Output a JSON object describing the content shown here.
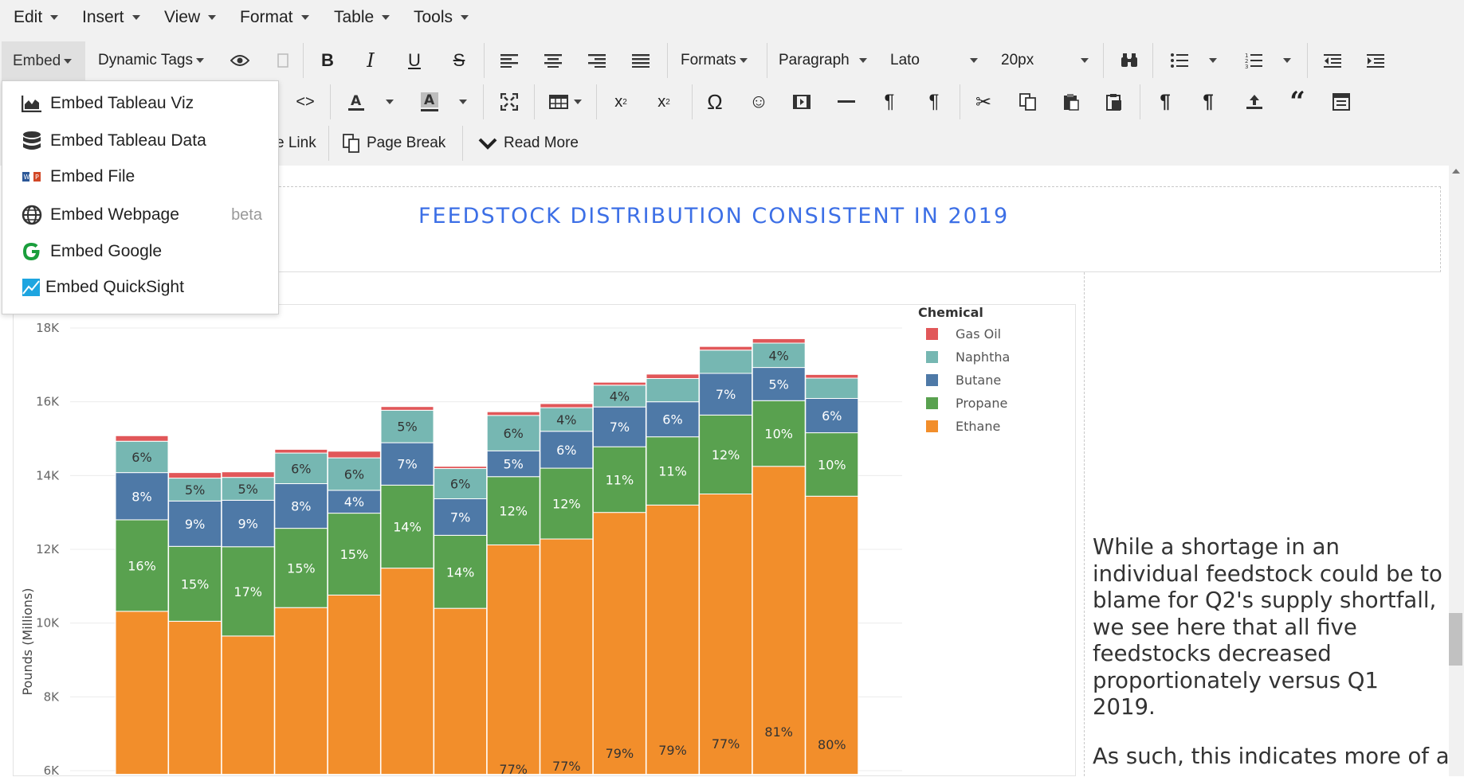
{
  "menubar": {
    "items": [
      "Edit",
      "Insert",
      "View",
      "Format",
      "Table",
      "Tools"
    ]
  },
  "toolbar": {
    "embed_label": "Embed",
    "dynamic_tags_label": "Dynamic Tags",
    "formats_label": "Formats",
    "paragraph_label": "Paragraph",
    "font_family_value": "Lato",
    "font_size_value": "20px",
    "link_label": "e Link",
    "page_break_label": "Page Break",
    "read_more_label": "Read More"
  },
  "embed_menu": {
    "items": [
      {
        "label": "Embed Tableau Viz",
        "icon": "area-chart-icon"
      },
      {
        "label": "Embed Tableau Data",
        "icon": "database-icon"
      },
      {
        "label": "Embed File",
        "icon": "file-icon"
      },
      {
        "label": "Embed Webpage",
        "icon": "globe-icon",
        "badge": "beta"
      },
      {
        "label": "Embed Google",
        "icon": "google-icon"
      },
      {
        "label": "Embed QuickSight",
        "icon": "quicksight-icon"
      }
    ]
  },
  "document": {
    "title": "FEEDSTOCK DISTRIBUTION CONSISTENT IN 2019",
    "paragraph1": [
      "While a shortage in an",
      "individual feedstock could be to",
      "blame for Q2's supply shortfall,",
      "we see here that all five",
      "feedstocks decreased",
      "proportionately versus Q1",
      "2019."
    ],
    "paragraph2_visible": "As such, this indicates more of a"
  },
  "colors": {
    "title": "#3c6fe6",
    "ethane": "#f28e2b",
    "propane": "#59a14f",
    "butane": "#4e79a7",
    "naphtha": "#76b7b2",
    "gas_oil": "#e15759"
  },
  "chart_data": {
    "type": "bar",
    "stacked": true,
    "ylabel": "Pounds (Millions)",
    "ylim": [
      6000,
      18500
    ],
    "yticks": [
      "6K",
      "8K",
      "10K",
      "12K",
      "14K",
      "16K",
      "18K"
    ],
    "legend_title": "Chemical",
    "legend_position": "right",
    "bars": [
      {
        "ethane": 10320,
        "propane": 2480,
        "butane": 1280,
        "naphtha": 850,
        "gas_oil": 150,
        "labels": {
          "ethane": "",
          "propane": "16%",
          "butane": "8%",
          "naphtha": "6%"
        }
      },
      {
        "ethane": 10050,
        "propane": 2030,
        "butane": 1230,
        "naphtha": 620,
        "gas_oil": 150,
        "labels": {
          "ethane": "",
          "propane": "15%",
          "butane": "9%",
          "naphtha": "5%"
        }
      },
      {
        "ethane": 9650,
        "propane": 2420,
        "butane": 1260,
        "naphtha": 620,
        "gas_oil": 150,
        "labels": {
          "ethane": "",
          "propane": "17%",
          "butane": "9%",
          "naphtha": "5%"
        }
      },
      {
        "ethane": 10420,
        "propane": 2150,
        "butane": 1210,
        "naphtha": 830,
        "gas_oil": 100,
        "labels": {
          "ethane": "",
          "propane": "15%",
          "butane": "8%",
          "naphtha": "6%"
        }
      },
      {
        "ethane": 10760,
        "propane": 2220,
        "butane": 620,
        "naphtha": 880,
        "gas_oil": 180,
        "labels": {
          "ethane": "",
          "propane": "15%",
          "butane": "4%",
          "naphtha": "6%"
        }
      },
      {
        "ethane": 11490,
        "propane": 2250,
        "butane": 1150,
        "naphtha": 880,
        "gas_oil": 100,
        "labels": {
          "ethane": "",
          "propane": "14%",
          "butane": "7%",
          "naphtha": "5%"
        }
      },
      {
        "ethane": 10400,
        "propane": 1980,
        "butane": 990,
        "naphtha": 820,
        "gas_oil": 60,
        "labels": {
          "ethane": "",
          "propane": "14%",
          "butane": "7%",
          "naphtha": "6%"
        }
      },
      {
        "ethane": 12120,
        "propane": 1850,
        "butane": 700,
        "naphtha": 960,
        "gas_oil": 100,
        "labels": {
          "ethane": "77%",
          "propane": "12%",
          "butane": "5%",
          "naphtha": "6%"
        }
      },
      {
        "ethane": 12280,
        "propane": 1920,
        "butane": 1000,
        "naphtha": 640,
        "gas_oil": 110,
        "labels": {
          "ethane": "77%",
          "propane": "12%",
          "butane": "6%",
          "naphtha": "4%"
        }
      },
      {
        "ethane": 13000,
        "propane": 1780,
        "butane": 1080,
        "naphtha": 590,
        "gas_oil": 80,
        "labels": {
          "ethane": "79%",
          "propane": "11%",
          "butane": "7%",
          "naphtha": "4%"
        }
      },
      {
        "ethane": 13200,
        "propane": 1850,
        "butane": 950,
        "naphtha": 630,
        "gas_oil": 120,
        "labels": {
          "ethane": "79%",
          "propane": "11%",
          "butane": "6%",
          "naphtha": ""
        }
      },
      {
        "ethane": 13500,
        "propane": 2140,
        "butane": 1130,
        "naphtha": 630,
        "gas_oil": 100,
        "labels": {
          "ethane": "77%",
          "propane": "12%",
          "butane": "7%",
          "naphtha": ""
        }
      },
      {
        "ethane": 14250,
        "propane": 1780,
        "butane": 900,
        "naphtha": 660,
        "gas_oil": 120,
        "labels": {
          "ethane": "81%",
          "propane": "10%",
          "butane": "5%",
          "naphtha": "4%"
        }
      },
      {
        "ethane": 13440,
        "propane": 1720,
        "butane": 930,
        "naphtha": 550,
        "gas_oil": 100,
        "labels": {
          "ethane": "80%",
          "propane": "10%",
          "butane": "6%",
          "naphtha": ""
        }
      }
    ],
    "series": [
      {
        "name": "Gas Oil",
        "key": "gas_oil",
        "color": "#e15759"
      },
      {
        "name": "Naphtha",
        "key": "naphtha",
        "color": "#76b7b2"
      },
      {
        "name": "Butane",
        "key": "butane",
        "color": "#4e79a7"
      },
      {
        "name": "Propane",
        "key": "propane",
        "color": "#59a14f"
      },
      {
        "name": "Ethane",
        "key": "ethane",
        "color": "#f28e2b"
      }
    ]
  }
}
